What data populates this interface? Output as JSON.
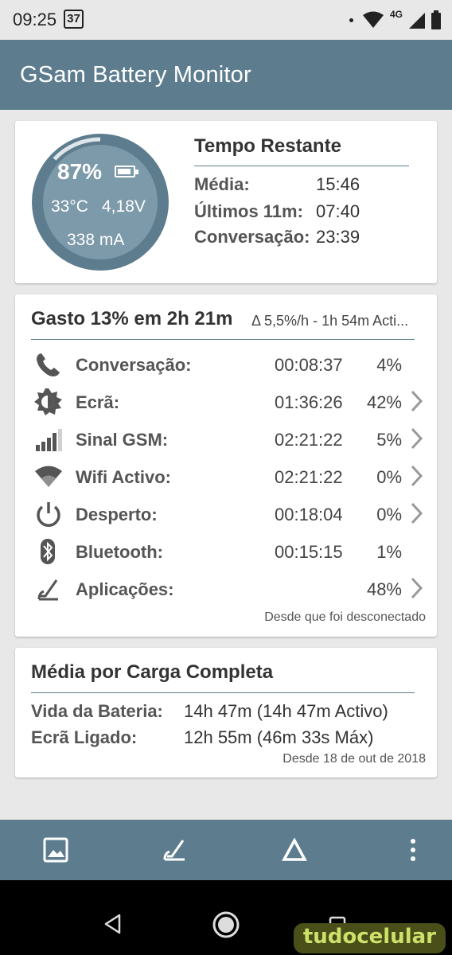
{
  "status_bar": {
    "time": "09:25",
    "calendar_day": "37",
    "network": "4G"
  },
  "app_bar": {
    "title": "GSam Battery Monitor"
  },
  "battery": {
    "percent": "87%",
    "temperature": "33°C",
    "voltage": "4,18V",
    "current": "338 mA",
    "level_fraction": 0.87
  },
  "tempo_restante": {
    "title": "Tempo Restante",
    "rows": [
      {
        "label": "Média:",
        "value": "15:46"
      },
      {
        "label": "Últimos 11m:",
        "value": "07:40"
      },
      {
        "label": "Conversação:",
        "value": "23:39"
      }
    ]
  },
  "gasto": {
    "title": "Gasto 13% em 2h 21m",
    "rate": "Δ 5,5%/h - 1h 54m Acti...",
    "rows": [
      {
        "label": "Conversação:",
        "time": "00:08:37",
        "pct": "4%",
        "icon": "phone-icon",
        "chevron": false
      },
      {
        "label": "Ecrã:",
        "time": "01:36:26",
        "pct": "42%",
        "icon": "brightness-icon",
        "chevron": true
      },
      {
        "label": "Sinal GSM:",
        "time": "02:21:22",
        "pct": "5%",
        "icon": "signal-icon",
        "chevron": true
      },
      {
        "label": "Wifi Activo:",
        "time": "02:21:22",
        "pct": "0%",
        "icon": "wifi-icon",
        "chevron": true
      },
      {
        "label": "Desperto:",
        "time": "00:18:04",
        "pct": "0%",
        "icon": "power-icon",
        "chevron": true
      },
      {
        "label": "Bluetooth:",
        "time": "00:15:15",
        "pct": "1%",
        "icon": "bluetooth-icon",
        "chevron": false
      },
      {
        "label": "Aplicações:",
        "time": "",
        "pct": "48%",
        "icon": "apps-gauge-icon",
        "chevron": true
      }
    ],
    "footer": "Desde que foi desconectado"
  },
  "media_carga": {
    "title": "Média por Carga Completa",
    "rows": [
      {
        "label": "Vida da Bateria:",
        "value": "14h 47m (14h 47m Activo)"
      },
      {
        "label": "Ecrã Ligado:",
        "value": "12h 55m (46m 33s Máx)"
      }
    ],
    "footer": "Desde 18 de out de 2018"
  },
  "bottom_bar": {
    "icons": [
      "image-icon",
      "gauge-icon",
      "delta-icon",
      "overflow-menu-icon"
    ]
  },
  "nav_bar": {
    "icons": [
      "back-icon",
      "home-icon",
      "recents-icon"
    ],
    "watermark": "tudocelular"
  },
  "colors": {
    "primary": "#5d7d8f",
    "gauge_ring": "#5d7d8f",
    "gauge_fill": "#7d9aaa",
    "background": "#e8e8e8"
  }
}
